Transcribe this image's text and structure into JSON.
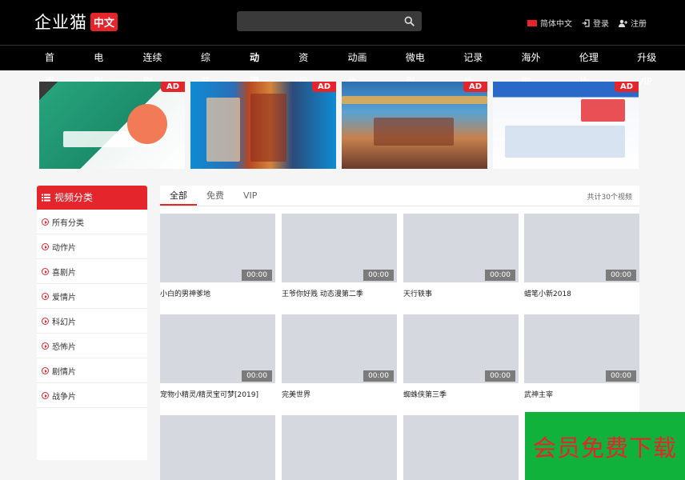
{
  "header": {
    "logo_text": "企业猫",
    "logo_badge": "中文",
    "search_placeholder": "",
    "links": [
      {
        "label": "简体中文",
        "icon": "china-flag-icon"
      },
      {
        "label": "登录",
        "icon": "login-icon"
      },
      {
        "label": "注册",
        "icon": "register-icon"
      }
    ]
  },
  "nav": {
    "items": [
      "首页",
      "电影",
      "连续剧",
      "综艺",
      "动漫",
      "资讯",
      "动画片",
      "微电影",
      "记录片",
      "海外剧",
      "伦理片",
      "升级VIP"
    ],
    "active_index": 4
  },
  "ads": {
    "tag": "AD",
    "count": 4
  },
  "sidebar": {
    "title": "视频分类",
    "items": [
      "所有分类",
      "动作片",
      "喜剧片",
      "爱情片",
      "科幻片",
      "恐怖片",
      "剧情片",
      "战争片"
    ]
  },
  "main": {
    "tabs": [
      "全部",
      "免费",
      "VIP"
    ],
    "active_tab": 0,
    "total": "共计30个视频",
    "videos": [
      {
        "title": "小白的男神爹地",
        "duration": "00:00"
      },
      {
        "title": "王爷你好贱 动态漫第二季",
        "duration": "00:00"
      },
      {
        "title": "天行轶事",
        "duration": "00:00"
      },
      {
        "title": "蜡笔小新2018",
        "duration": "00:00"
      },
      {
        "title": "宠物小精灵/精灵宝可梦[2019]",
        "duration": "00:00"
      },
      {
        "title": "完美世界",
        "duration": "00:00"
      },
      {
        "title": "蜘蛛侠第三季",
        "duration": "00:00"
      },
      {
        "title": "武神主宰",
        "duration": "00:00"
      },
      {
        "title": "",
        "duration": ""
      },
      {
        "title": "",
        "duration": ""
      },
      {
        "title": "",
        "duration": ""
      }
    ]
  },
  "promo": {
    "text": "会员免费下载"
  },
  "colors": {
    "brand_red": "#e4262c",
    "header_bg": "#000000",
    "promo_green": "#10b23b"
  }
}
